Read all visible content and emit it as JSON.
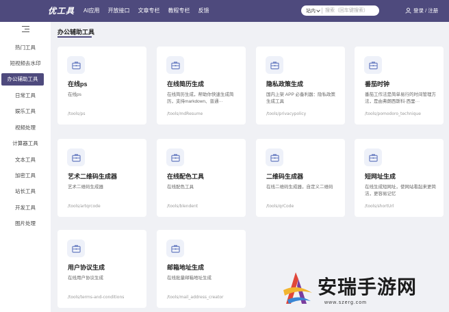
{
  "header": {
    "logo": "优工具",
    "nav": [
      "AI应用",
      "开放接口",
      "文章专栏",
      "教程专栏",
      "反馈"
    ],
    "search": {
      "scope": "站内",
      "placeholder": "搜索（回车键搜索）"
    },
    "login": "登录 / 注册"
  },
  "sidebar": {
    "items": [
      "热门工具",
      "短视频去水印",
      "办公辅助工具",
      "日常工具",
      "娱乐工具",
      "视频处理",
      "计算器工具",
      "文本工具",
      "加密工具",
      "站长工具",
      "开发工具",
      "图片处理"
    ],
    "active_index": 2
  },
  "main": {
    "section_title": "办公辅助工具",
    "cards": [
      {
        "title": "在线ps",
        "desc": "在线ps",
        "path": "/tools/ps"
      },
      {
        "title": "在线简历生成",
        "desc": "在线简历生成，帮助你快速生成简历，支持markdown、普通···",
        "path": "/tools/mdResume"
      },
      {
        "title": "隐私政策生成",
        "desc": "国内上架 APP 必备利器：隐私政策生成工具",
        "path": "/tools/privacypolicy"
      },
      {
        "title": "番茄时钟",
        "desc": "番茄工作法是简单易行的时间管理方法，是由弗朗西斯科·西里···",
        "path": "/tools/pomodoro_technique"
      },
      {
        "title": "艺术二维码生成器",
        "desc": "艺术二维码生成器",
        "path": "/tools/artqrcode"
      },
      {
        "title": "在线配色工具",
        "desc": "在线配色工具",
        "path": "/tools/blendent"
      },
      {
        "title": "二维码生成器",
        "desc": "在线二维码生成器，自定义二维码",
        "path": "/tools/qrCode"
      },
      {
        "title": "短网址生成",
        "desc": "在线生成短网址，使网站看起来更简洁，更容易记忆",
        "path": "/tools/shortUrl"
      },
      {
        "title": "用户协议生成",
        "desc": "在线用户协议生成",
        "path": "/tools/terms-and-conditions"
      },
      {
        "title": "邮箱地址生成",
        "desc": "在线批量邮箱地址生成",
        "path": "/tools/mail_address_creator"
      }
    ]
  },
  "watermark": {
    "text": "安瑞手游网",
    "url": "www.szerg.com"
  },
  "colors": {
    "primary": "#4e4a7d",
    "background": "#f0f1f5",
    "icon": "#6b7fc2"
  }
}
